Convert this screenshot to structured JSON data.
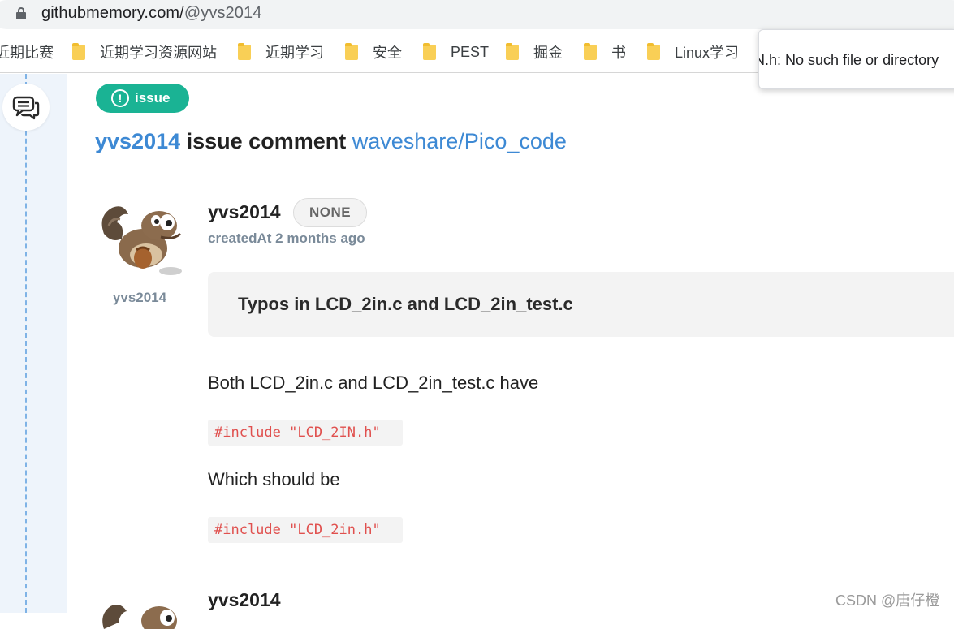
{
  "browser": {
    "url_host": "githubmemory.com/",
    "url_path": "@yvs2014",
    "bookmarks": [
      "近期比赛",
      "近期学习资源网站",
      "近期学习",
      "安全",
      "PEST",
      "掘金",
      "书",
      "Linux学习"
    ],
    "popup_text": "N.h: No such file or directory"
  },
  "page": {
    "tag_label": "issue",
    "headline": {
      "user": "yvs2014",
      "action": "issue comment",
      "repo": "waveshare/Pico_code"
    },
    "comment": {
      "author": "yvs2014",
      "badge": "NONE",
      "created_label": "createdAt",
      "created_value": "2 months ago",
      "avatar_caption": "yvs2014",
      "issue_title": "Typos in LCD_2in.c and LCD_2in_test.c",
      "body_line1": "Both LCD_2in.c and LCD_2in_test.c have",
      "code1": "#include \"LCD_2IN.h\"",
      "body_line2": "Which should be",
      "code2": "#include \"LCD_2in.h\""
    },
    "next_comment_author": "yvs2014",
    "watermark": "CSDN @唐仔橙"
  },
  "colors": {
    "tag_green": "#1ab394",
    "link_blue": "#3d89d4",
    "code_red": "#e0504e",
    "rail_bg": "#eef4fb",
    "dash": "#7fb3e6"
  }
}
